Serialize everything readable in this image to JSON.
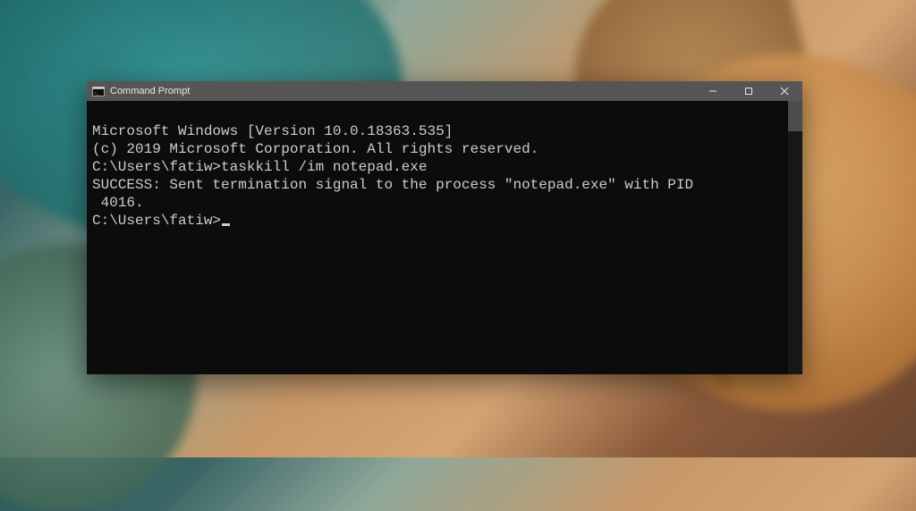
{
  "window": {
    "title": "Command Prompt"
  },
  "terminal": {
    "banner1": "Microsoft Windows [Version 10.0.18363.535]",
    "banner2": "(c) 2019 Microsoft Corporation. All rights reserved.",
    "blank1": "",
    "prompt1_path": "C:\\Users\\fatiw>",
    "prompt1_cmd": "taskkill /im notepad.exe",
    "result1": "SUCCESS: Sent termination signal to the process \"notepad.exe\" with PID",
    "result2": " 4016.",
    "blank2": "",
    "prompt2_path": "C:\\Users\\fatiw>"
  }
}
